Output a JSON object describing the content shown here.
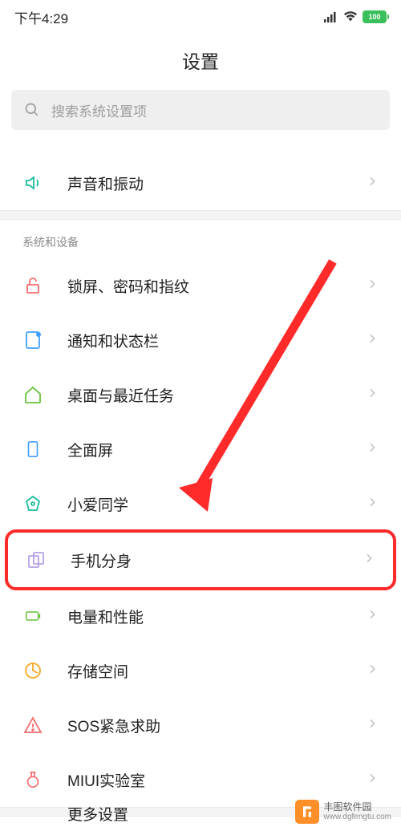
{
  "status": {
    "time": "下午4:29",
    "battery": "100"
  },
  "header": {
    "title": "设置"
  },
  "search": {
    "placeholder": "搜索系统设置项"
  },
  "topItem": {
    "label": "声音和振动"
  },
  "section": {
    "header": "系统和设备",
    "items": [
      {
        "label": "锁屏、密码和指纹",
        "icon": "lock",
        "color": "#f56c6c"
      },
      {
        "label": "通知和状态栏",
        "icon": "notification",
        "color": "#409eff"
      },
      {
        "label": "桌面与最近任务",
        "icon": "home",
        "color": "#67c23a"
      },
      {
        "label": "全面屏",
        "icon": "fullscreen",
        "color": "#409eff"
      },
      {
        "label": "小爱同学",
        "icon": "xiaoai",
        "color": "#1abc9c"
      },
      {
        "label": "手机分身",
        "icon": "clone",
        "color": "#b8a0e8",
        "highlighted": true
      },
      {
        "label": "电量和性能",
        "icon": "battery",
        "color": "#67c23a"
      },
      {
        "label": "存储空间",
        "icon": "storage",
        "color": "#f5a623"
      },
      {
        "label": "SOS紧急求助",
        "icon": "sos",
        "color": "#f56c6c"
      },
      {
        "label": "MIUI实验室",
        "icon": "lab",
        "color": "#f56c6c"
      }
    ]
  },
  "bottom": {
    "label": "更多设置"
  },
  "watermark": {
    "name": "丰图软件园",
    "url": "www.dgfengtu.com"
  },
  "annotation": {
    "arrow_color": "#ff2a2a"
  }
}
